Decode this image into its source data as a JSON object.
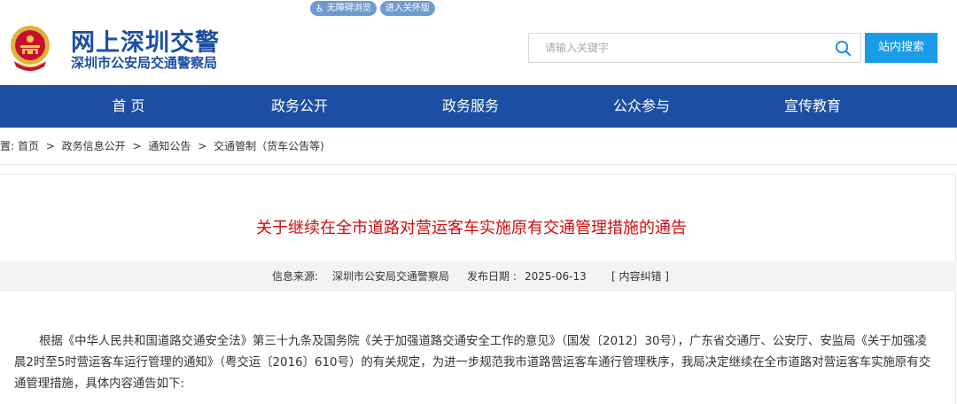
{
  "accessibility": {
    "barrier_free": "无障碍浏览",
    "elder_mode": "进入关怀版"
  },
  "header": {
    "site_title": "网上深圳交警",
    "site_subtitle": "深圳市公安局交通警察局",
    "search_placeholder": "请输入关键字",
    "search_button": "站内搜索"
  },
  "nav": {
    "items": [
      "首 页",
      "政务公开",
      "政务服务",
      "公众参与",
      "宣传教育"
    ]
  },
  "breadcrumb": {
    "prefix": "位置:",
    "items": [
      "首页",
      "政务信息公开",
      "通知公告",
      "交通管制（货车公告等)"
    ],
    "separator": ">"
  },
  "article": {
    "title": "关于继续在全市道路对营运客车实施原有交通管理措施的通告",
    "source_label": "信息来源:",
    "source": "深圳市公安局交通警察局",
    "date_label": "发布日期 :",
    "date": "2025-06-13",
    "correction": "[ 内容纠错 ]",
    "paragraph_1": "根据《中华人民共和国道路交通安全法》第三十九条及国务院《关于加强道路交通安全工作的意见》（国发〔2012〕30号），广东省交通厅、公安厅、安监局《关于加强凌晨2时至5时营运客车运行管理的通知》（粤交运〔2016〕610号）的有关规定，为进一步规范我市道路营运客车通行管理秩序，我局决定继续在全市道路对营运客车实施原有交通管理措施，具体内容通告如下:"
  },
  "colors": {
    "brand_blue": "#1c4fa3",
    "search_blue": "#199be8",
    "title_red": "#d10b0b",
    "pill_blue": "#6f9bd0"
  }
}
